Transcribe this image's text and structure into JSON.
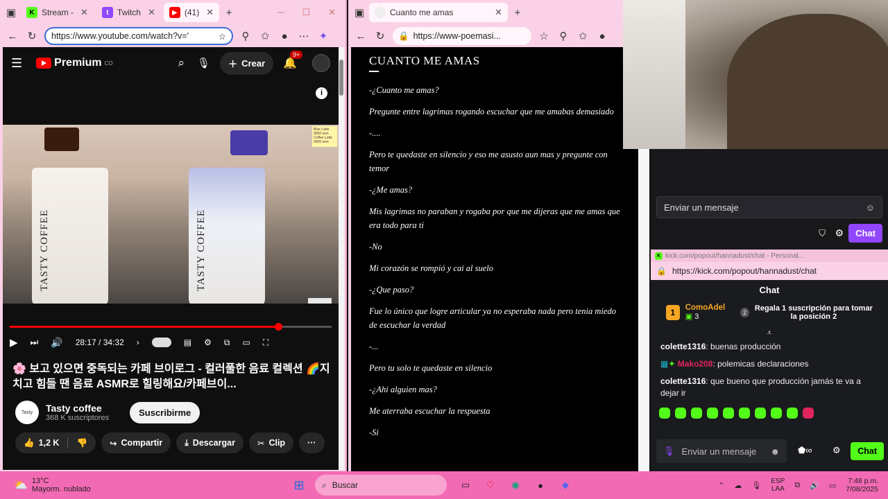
{
  "left_browser": {
    "tabs": [
      {
        "label": "Stream -",
        "icon": "kick-icon"
      },
      {
        "label": "Twitch",
        "icon": "twitch-icon"
      },
      {
        "label": "(41)",
        "icon": "youtube-icon"
      }
    ],
    "url": "https://www.youtube.com/watch?v='",
    "new_tab": "+"
  },
  "youtube": {
    "logo": "Premium",
    "country": "CO",
    "create_label": "Crear",
    "notif_count": "9+",
    "cup_text_left": "TASTY COFFEE",
    "cup_text_right": "TASTY COFFEE",
    "sign_text": "Blue Latte 9500 won Coffee Latte 9500 won",
    "time": "28:17 / 34:32",
    "progress": 0.84,
    "title": "🌸 보고 있으면 중독되는 카페 브이로그 - 컬러풀한 음료 컬렉션 🌈지치고 힘들 땐 음료 ASMR로 힐링해요/카페브이...",
    "channel": "Tasty coffee",
    "subscribers": "368 K suscriptores",
    "subscribe_label": "Suscribirme",
    "likes": "1,2 K",
    "share_label": "Compartir",
    "download_label": "Descargar",
    "clip_label": "Clip",
    "more_label": "···"
  },
  "middle_browser": {
    "tab_label": "Cuanto me amas",
    "url": "https://www-poemasi...",
    "new_tab": "+"
  },
  "poem": {
    "title": "CUANTO ME AMAS",
    "lines": [
      " -¿Cuanto me amas?",
      "Pregunte entre lagrimas rogando escuchar que me amabas demasiado",
      "-....",
      "Pero te quedaste en silencio y eso me asusto aun mas y pregunte con temor",
      "-¿Me amas?",
      "Mis lagrimas no paraban y rogaba por que me dijeras que me amas que era todo para ti",
      "-No",
      "Mi corazón se rompió y cai al suelo",
      "-¿Que paso?",
      "Fue lo único que logre articular ya no esperaba nada pero tenia miedo de escuchar la verdad",
      "-...",
      "Pero tu solo te quedaste en  silencio",
      "-¿Ahi alguien mas?",
      "Me aterraba escuchar la respuesta",
      "-Si"
    ]
  },
  "twitch": {
    "input_placeholder": "Enviar un mensaje",
    "chat_button": "Chat"
  },
  "kick": {
    "window_title": "kick.com/popout/hannadust/chat - Personal...",
    "url": "https://kick.com/popout/hannadust/chat",
    "header": "Chat",
    "leader_rank": "1",
    "leader_name": "ComoAdel",
    "leader_count": "3",
    "gift_rank": "2",
    "gift_text": "Regala 1 suscripción para tomar la posición 2",
    "messages": [
      {
        "user": "colette1316",
        "text": "buenas producción",
        "color": "#ffffff"
      },
      {
        "user": "Mako208",
        "text": "polemicas declaraciones",
        "color": "#e0245e"
      },
      {
        "user": "colette1316",
        "text": "que bueno que producción jamás te va a dejar ir",
        "color": "#ffffff"
      }
    ],
    "input_placeholder": "Enviar un mensaje",
    "chat_button": "Chat"
  },
  "taskbar": {
    "weather_temp": "13°C",
    "weather_desc": "Mayorm. nublado",
    "search_placeholder": "Buscar",
    "lang_top": "ESP",
    "lang_bottom": "LAA",
    "time": "7:48 p.m.",
    "date": "7/08/2025"
  },
  "colors": {
    "browser_pink": "#fad1e6",
    "taskbar_pink": "#f36ab4",
    "twitch_purple": "#9147ff",
    "kick_green": "#53fc18",
    "youtube_red": "#ff0000"
  }
}
